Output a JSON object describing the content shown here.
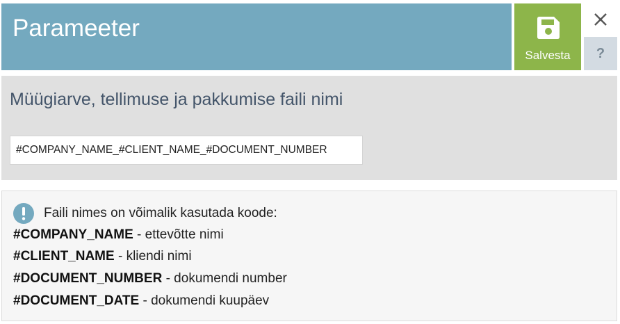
{
  "header": {
    "title": "Parameeter",
    "save_label": "Salvesta",
    "help_label": "?"
  },
  "icons": {
    "save": "floppy-disk-icon",
    "close": "close-icon",
    "info": "info-exclamation-icon"
  },
  "colors": {
    "header_bg": "#74a9bf",
    "save_bg": "#8db54a",
    "help_bg": "#d3dbe2",
    "panel_bg": "#e0e0e0",
    "info_icon": "#74a9bf"
  },
  "parameter": {
    "label": "Müügiarve, tellimuse ja pakkumise faili nimi",
    "value": "#COMPANY_NAME_#CLIENT_NAME_#DOCUMENT_NUMBER"
  },
  "info": {
    "intro": "Faili nimes on võimalik kasutada koode:",
    "codes": [
      {
        "code": "#COMPANY_NAME",
        "description": " - ettevõtte nimi"
      },
      {
        "code": "#CLIENT_NAME",
        "description": " - kliendi nimi"
      },
      {
        "code": "#DOCUMENT_NUMBER",
        "description": " - dokumendi number"
      },
      {
        "code": "#DOCUMENT_DATE",
        "description": " - dokumendi kuupäev"
      }
    ]
  }
}
